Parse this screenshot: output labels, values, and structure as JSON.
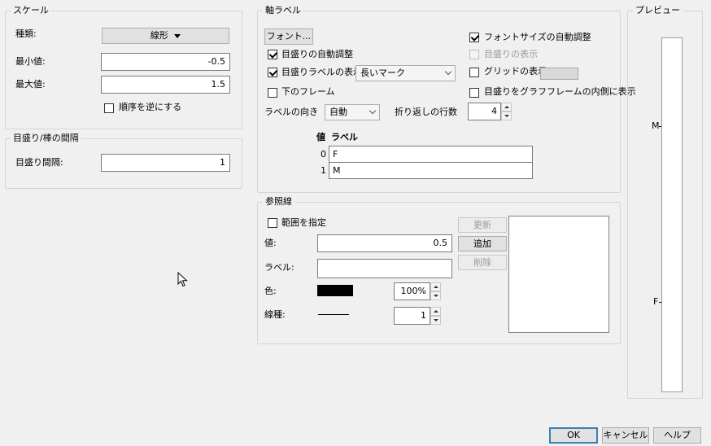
{
  "scale": {
    "title": "スケール",
    "type_label": "種類:",
    "type_value": "線形",
    "min_label": "最小値:",
    "min_value": "-0.5",
    "max_label": "最大値:",
    "max_value": "1.5",
    "reverse_label": "順序を逆にする"
  },
  "interval": {
    "title": "目盛り/棒の間隔",
    "label": "目盛り間隔:",
    "value": "1"
  },
  "axis_label": {
    "title": "軸ラベル",
    "font_button": "フォント...",
    "auto_tick": "目盛りの自動調整",
    "show_tick_labels": "目盛りラベルの表示",
    "tick_mark_value": "長いマーク",
    "lower_frame": "下のフレーム",
    "orientation_label": "ラベルの向き",
    "orientation_value": "自動",
    "wrap_label": "折り返しの行数",
    "wrap_value": "4",
    "auto_font_size": "フォントサイズの自動調整",
    "show_ticks": "目盛りの表示",
    "show_grid": "グリッドの表示",
    "grid_color": "#d9d9d9",
    "ticks_inside": "目盛りをグラフフレームの内側に表示",
    "table_value_header": "値",
    "table_label_header": "ラベル",
    "rows": [
      {
        "value": "0",
        "label": "F"
      },
      {
        "value": "1",
        "label": "M"
      }
    ]
  },
  "preview": {
    "title": "プレビュー",
    "tick_top": "M",
    "tick_bottom": "F"
  },
  "reference_line": {
    "title": "参照線",
    "range_label": "範囲を指定",
    "value_label": "値:",
    "value": "0.5",
    "label_label": "ラベル:",
    "label_value": "",
    "color_label": "色:",
    "color": "#000000",
    "opacity": "100%",
    "line_type_label": "線種:",
    "line_width": "1",
    "update_button": "更新",
    "add_button": "追加",
    "delete_button": "削除"
  },
  "footer": {
    "ok": "OK",
    "cancel": "キャンセル",
    "help": "ヘルプ"
  }
}
